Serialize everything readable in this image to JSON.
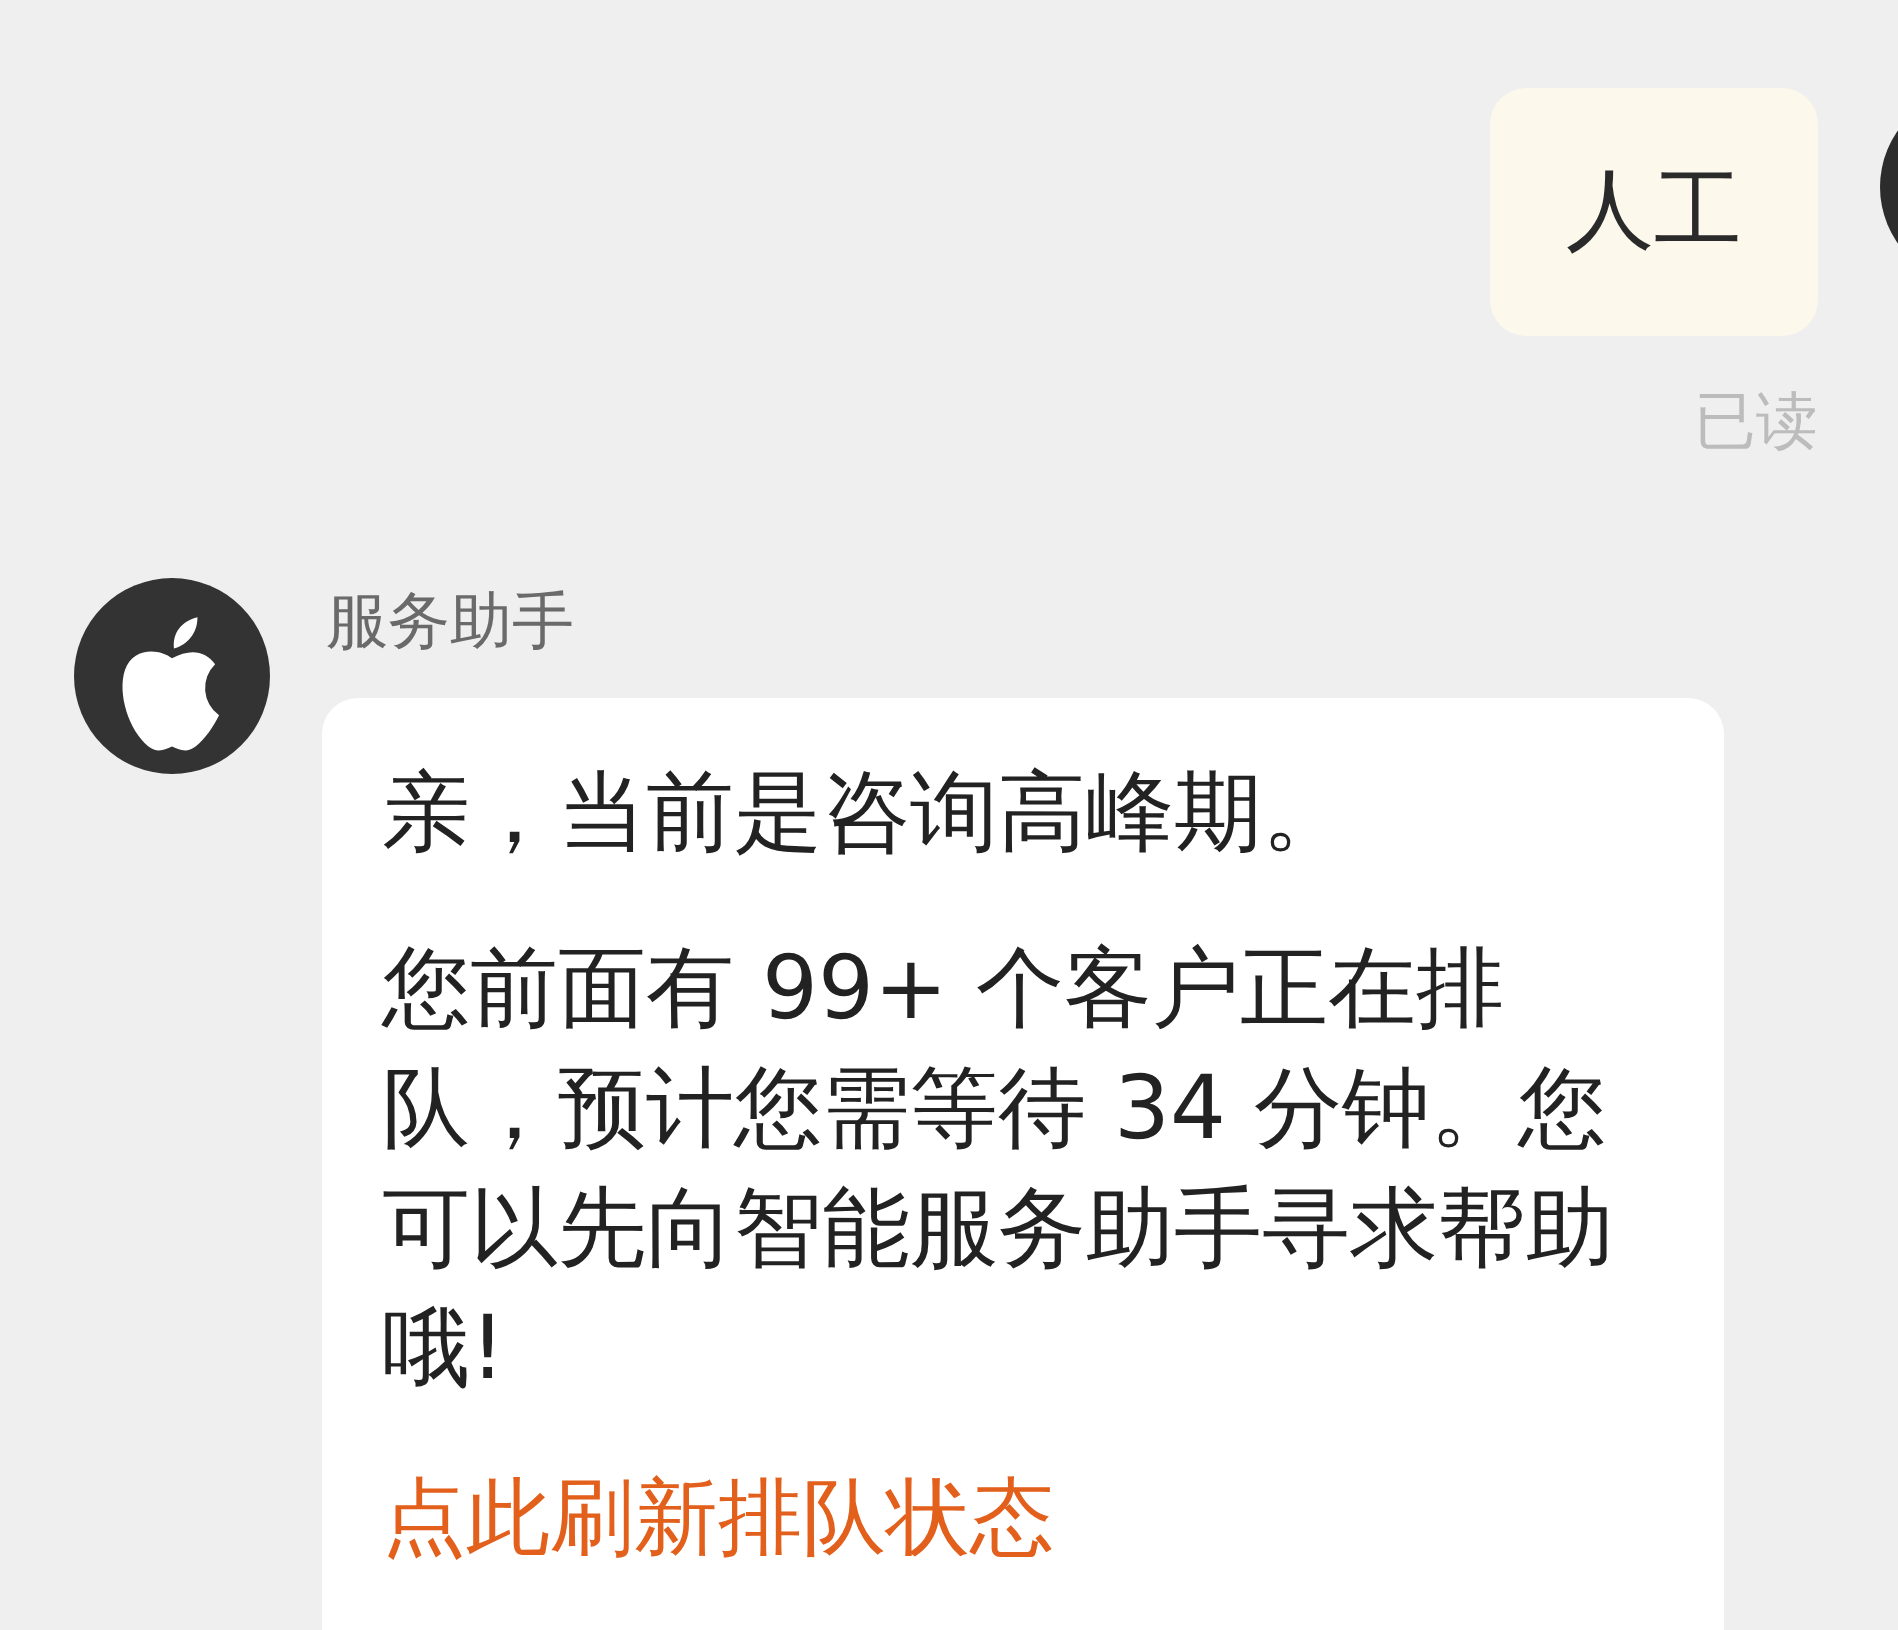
{
  "outgoing": {
    "text": "人工",
    "receipt": "已读"
  },
  "incoming": {
    "sender": "服务助手",
    "paragraphs": [
      "亲，当前是咨询高峰期。",
      "您前面有 99+ 个客户正在排队，预计您需等待 34 分钟。您可以先向智能服务助手寻求帮助哦!"
    ],
    "link": "点此刷新排队状态"
  }
}
